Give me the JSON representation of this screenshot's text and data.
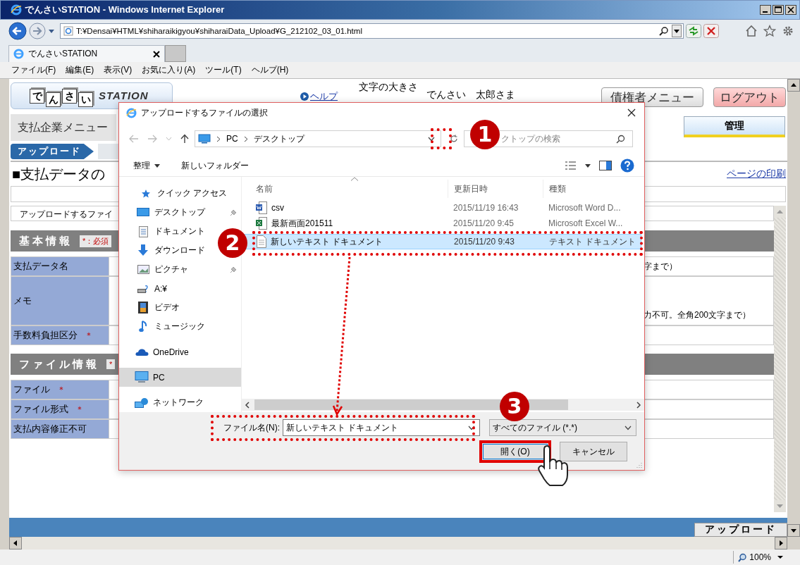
{
  "browser": {
    "title": "でんさいSTATION - Windows Internet Explorer",
    "address": "T:¥Densai¥HTML¥shiharaikigyou¥shiharaiData_Upload¥G_212102_03_01.html",
    "tabs": [
      {
        "label": "でんさいSTATION",
        "selected": true
      }
    ],
    "menu": [
      "ファイル(F)",
      "編集(E)",
      "表示(V)",
      "お気に入り(A)",
      "ツール(T)",
      "ヘルプ(H)"
    ],
    "zoom": "100%"
  },
  "page": {
    "logo": {
      "chars": [
        "で",
        "ん",
        "さ",
        "い"
      ],
      "text": "STATION"
    },
    "help_link": "ヘルプ",
    "font_size_label": "文字の大きさ",
    "user": "でんさい　太郎さま",
    "header_buttons": [
      {
        "label": "債権者メニュー",
        "kind": "menu"
      },
      {
        "label": "ログアウト",
        "kind": "logout"
      }
    ],
    "menu_title": "支払企業メニュー",
    "tabs": [
      {
        "label": "管理",
        "selected": false
      }
    ],
    "breadcrumb": [
      {
        "label": "アップロード",
        "selected": true
      }
    ],
    "heading": "■支払データの",
    "print_link": "ページの印刷",
    "instruction": "アップロードするファイ",
    "sections": [
      {
        "title": "基本情報",
        "badge": "*：必須",
        "rows": [
          {
            "label": "支払データ名",
            "kind": "text",
            "note": "字まで）"
          },
          {
            "label": "メモ",
            "kind": "textarea",
            "note": "力不可。全角200文字まで）"
          },
          {
            "label": "手数料負担区分",
            "mark": "＊",
            "kind": "radio"
          }
        ]
      },
      {
        "title": "ファイル情報",
        "badge": "*",
        "rows": [
          {
            "label": "ファイル",
            "mark": "＊",
            "kind": "text"
          },
          {
            "label": "ファイル形式",
            "mark": "＊",
            "kind": "radio"
          },
          {
            "label": "支払内容修正不可",
            "kind": "checkbox"
          }
        ]
      }
    ],
    "footer_button": "アップロード"
  },
  "dialog": {
    "title": "アップロードするファイルの選択",
    "path": [
      "PC",
      "デスクトップ"
    ],
    "search_placeholder": "クトップの検索",
    "toolbar": [
      "整理",
      "新しいフォルダー"
    ],
    "nav": [
      {
        "label": "クイック アクセス",
        "kind": "star",
        "pinned": false,
        "selected": false
      },
      {
        "label": "デスクトップ",
        "kind": "desktop",
        "pinned": true,
        "selected": false
      },
      {
        "label": "ドキュメント",
        "kind": "document",
        "pinned": false,
        "selected": false
      },
      {
        "label": "ダウンロード",
        "kind": "download",
        "pinned": false,
        "selected": false
      },
      {
        "label": "ピクチャ",
        "kind": "picture",
        "pinned": true,
        "selected": false
      },
      {
        "label": "A:¥",
        "kind": "drive",
        "pinned": false,
        "selected": false
      },
      {
        "label": "ビデオ",
        "kind": "video",
        "pinned": false,
        "selected": false
      },
      {
        "label": "ミュージック",
        "kind": "music",
        "pinned": false,
        "selected": false
      },
      {
        "label": "OneDrive",
        "kind": "cloud",
        "pinned": false,
        "selected": false
      },
      {
        "label": "PC",
        "kind": "pc",
        "pinned": false,
        "selected": true
      },
      {
        "label": "ネットワーク",
        "kind": "network",
        "pinned": false,
        "selected": false
      }
    ],
    "columns": [
      "名前",
      "更新日時",
      "種類"
    ],
    "files": [
      {
        "name": "csv",
        "modified": "2015/11/19 16:43",
        "type": "Microsoft Word D...",
        "kind": "word",
        "selected": false
      },
      {
        "name": "最新画面201511",
        "modified": "2015/11/20 9:45",
        "type": "Microsoft Excel W...",
        "kind": "excel",
        "selected": false
      },
      {
        "name": "新しいテキスト ドキュメント",
        "modified": "2015/11/20 9:43",
        "type": "テキスト ドキュメント",
        "kind": "text",
        "selected": true
      }
    ],
    "filename_label": "ファイル名(N):",
    "filename": "新しいテキスト ドキュメント",
    "filter": "すべてのファイル (*.*)",
    "buttons": [
      {
        "label": "開く(O)",
        "highlighted": true
      },
      {
        "label": "キャンセル",
        "highlighted": false
      }
    ]
  },
  "callouts": [
    "1",
    "2",
    "3"
  ]
}
